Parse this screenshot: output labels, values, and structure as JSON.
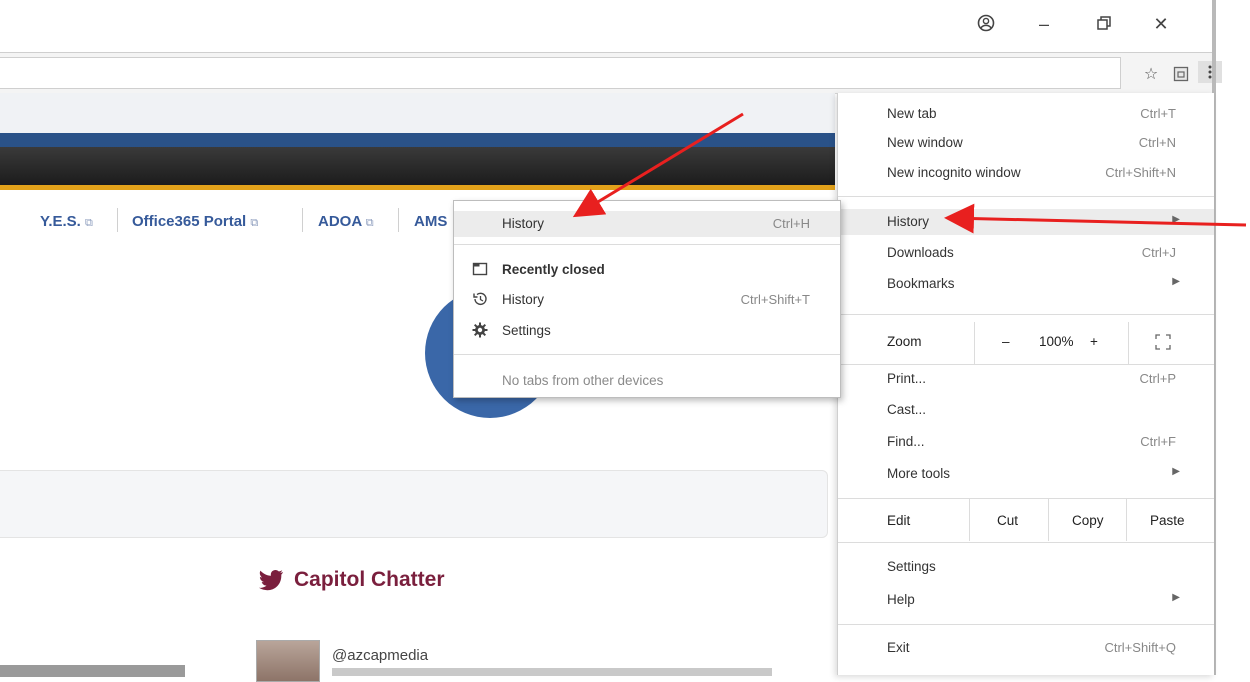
{
  "window": {
    "profile_icon": "account-circle-icon",
    "minimize_glyph": "–",
    "restore_glyph": "⧉",
    "close_glyph": "✕"
  },
  "toolbar": {
    "star_icon": "bookmark-star-icon",
    "extension_icon": "extension-icon",
    "menu_icon": "kebab-menu-icon"
  },
  "nav_links": [
    {
      "label": "Y.E.S."
    },
    {
      "label": "Office365 Portal"
    },
    {
      "label": "ADOA"
    },
    {
      "label": "AMS"
    }
  ],
  "widget": {
    "title": "Capitol Chatter",
    "handle": "@azcapmedia"
  },
  "chrome_menu": {
    "new_tab": {
      "label": "New tab",
      "shortcut": "Ctrl+T"
    },
    "new_window": {
      "label": "New window",
      "shortcut": "Ctrl+N"
    },
    "new_incognito": {
      "label": "New incognito window",
      "shortcut": "Ctrl+Shift+N"
    },
    "history": {
      "label": "History"
    },
    "downloads": {
      "label": "Downloads",
      "shortcut": "Ctrl+J"
    },
    "bookmarks": {
      "label": "Bookmarks"
    },
    "zoom": {
      "label": "Zoom",
      "minus": "–",
      "value": "100%",
      "plus": "+"
    },
    "print": {
      "label": "Print...",
      "shortcut": "Ctrl+P"
    },
    "cast": {
      "label": "Cast..."
    },
    "find": {
      "label": "Find...",
      "shortcut": "Ctrl+F"
    },
    "more_tools": {
      "label": "More tools"
    },
    "edit": {
      "label": "Edit",
      "cut": "Cut",
      "copy": "Copy",
      "paste": "Paste"
    },
    "settings": {
      "label": "Settings"
    },
    "help": {
      "label": "Help"
    },
    "exit": {
      "label": "Exit",
      "shortcut": "Ctrl+Shift+Q"
    }
  },
  "history_submenu": {
    "history": {
      "label": "History",
      "shortcut": "Ctrl+H"
    },
    "recently_closed": {
      "label": "Recently closed"
    },
    "closed_history": {
      "label": "History",
      "shortcut": "Ctrl+Shift+T"
    },
    "settings": {
      "label": "Settings"
    },
    "no_tabs": {
      "label": "No tabs from other devices"
    }
  },
  "colors": {
    "nav_link": "#365a9a",
    "header_blue": "#2a5288",
    "header_gold": "#e3a21a",
    "chatter": "#7a1f3d",
    "annotation_arrow": "#e8201f"
  }
}
